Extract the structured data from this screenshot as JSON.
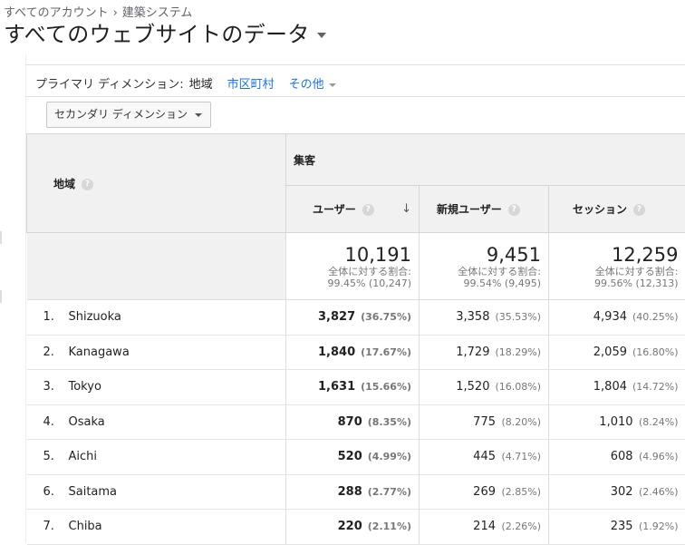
{
  "breadcrumb": {
    "account": "すべてのアカウント",
    "separator": "›",
    "property": "建築システム"
  },
  "view_title": "すべてのウェブサイトのデータ",
  "primary_dimension": {
    "label": "プライマリ ディメンション:",
    "current": "地域",
    "options": [
      "市区町村",
      "その他"
    ]
  },
  "secondary_dimension_label": "セカンダリ ディメンション",
  "table": {
    "dimension_header": "地域",
    "group_header": "集客",
    "columns": [
      "ユーザー",
      "新規ユーザー",
      "セッション"
    ],
    "sort_icon": "arrow-down-icon",
    "totals": [
      {
        "value": "10,191",
        "caption": "全体に対する割合:",
        "detail": "99.45% (10,247)"
      },
      {
        "value": "9,451",
        "caption": "全体に対する割合:",
        "detail": "99.54% (9,495)"
      },
      {
        "value": "12,259",
        "caption": "全体に対する割合:",
        "detail": "99.56% (12,313)"
      }
    ],
    "rows": [
      {
        "index": "1.",
        "region": "Shizuoka",
        "users": "3,827",
        "users_pct": "(36.75%)",
        "new_users": "3,358",
        "new_users_pct": "(35.53%)",
        "sessions": "4,934",
        "sessions_pct": "(40.25%)"
      },
      {
        "index": "2.",
        "region": "Kanagawa",
        "users": "1,840",
        "users_pct": "(17.67%)",
        "new_users": "1,729",
        "new_users_pct": "(18.29%)",
        "sessions": "2,059",
        "sessions_pct": "(16.80%)"
      },
      {
        "index": "3.",
        "region": "Tokyo",
        "users": "1,631",
        "users_pct": "(15.66%)",
        "new_users": "1,520",
        "new_users_pct": "(16.08%)",
        "sessions": "1,804",
        "sessions_pct": "(14.72%)"
      },
      {
        "index": "4.",
        "region": "Osaka",
        "users": "870",
        "users_pct": "(8.35%)",
        "new_users": "775",
        "new_users_pct": "(8.20%)",
        "sessions": "1,010",
        "sessions_pct": "(8.24%)"
      },
      {
        "index": "5.",
        "region": "Aichi",
        "users": "520",
        "users_pct": "(4.99%)",
        "new_users": "445",
        "new_users_pct": "(4.71%)",
        "sessions": "608",
        "sessions_pct": "(4.96%)"
      },
      {
        "index": "6.",
        "region": "Saitama",
        "users": "288",
        "users_pct": "(2.77%)",
        "new_users": "269",
        "new_users_pct": "(2.85%)",
        "sessions": "302",
        "sessions_pct": "(2.46%)"
      },
      {
        "index": "7.",
        "region": "Chiba",
        "users": "220",
        "users_pct": "(2.11%)",
        "new_users": "214",
        "new_users_pct": "(2.26%)",
        "sessions": "235",
        "sessions_pct": "(1.92%)"
      }
    ]
  },
  "colors": {
    "link": "#1a73e8",
    "header_bg": "#f1f1f1",
    "border": "#d6d6d6"
  }
}
